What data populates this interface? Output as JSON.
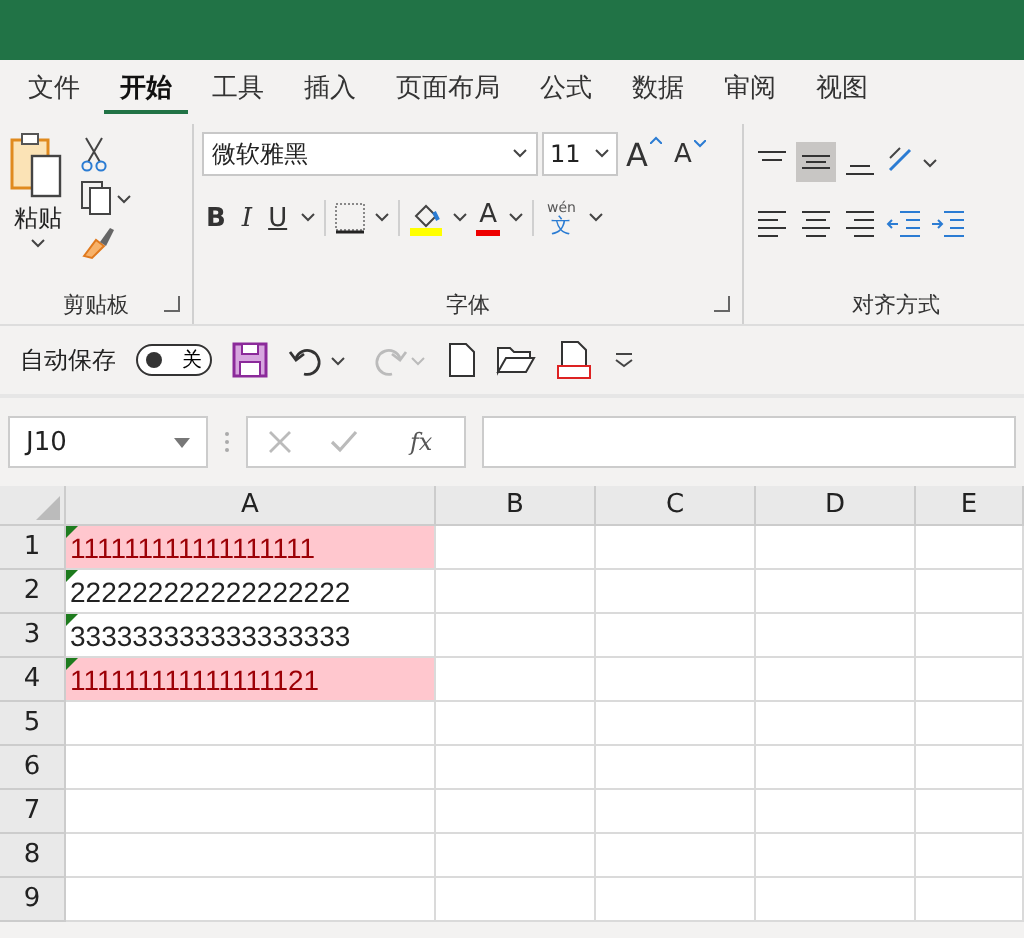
{
  "tabs": [
    {
      "label": "文件",
      "selected": false
    },
    {
      "label": "开始",
      "selected": true
    },
    {
      "label": "工具",
      "selected": false
    },
    {
      "label": "插入",
      "selected": false
    },
    {
      "label": "页面布局",
      "selected": false
    },
    {
      "label": "公式",
      "selected": false
    },
    {
      "label": "数据",
      "selected": false
    },
    {
      "label": "审阅",
      "selected": false
    },
    {
      "label": "视图",
      "selected": false
    }
  ],
  "ribbon": {
    "clipboard": {
      "paste_label": "粘贴",
      "group_label": "剪贴板"
    },
    "font": {
      "font_name": "微软雅黑",
      "font_size": "11",
      "grow": "A",
      "shrink": "A",
      "bold": "B",
      "italic": "I",
      "underline": "U",
      "font_color_letter": "A",
      "phonetic_top": "wén",
      "phonetic_bottom": "文",
      "group_label": "字体"
    },
    "alignment": {
      "group_label": "对齐方式",
      "middle_selected": true
    }
  },
  "quick_access": {
    "autosave_label": "自动保存",
    "autosave_on": false,
    "toggle_text": "关"
  },
  "formula_bar": {
    "name_box": "J10",
    "fx": "fx"
  },
  "sheet": {
    "columns": [
      "A",
      "B",
      "C",
      "D",
      "E"
    ],
    "rows": [
      {
        "number": "1",
        "value": "111111111111111111",
        "highlighted": true,
        "flag": true
      },
      {
        "number": "2",
        "value": "222222222222222222",
        "highlighted": false,
        "flag": true
      },
      {
        "number": "3",
        "value": "333333333333333333",
        "highlighted": false,
        "flag": true
      },
      {
        "number": "4",
        "value": "111111111111111121",
        "highlighted": true,
        "flag": true
      },
      {
        "number": "5",
        "value": "",
        "highlighted": false,
        "flag": false
      },
      {
        "number": "6",
        "value": "",
        "highlighted": false,
        "flag": false
      },
      {
        "number": "7",
        "value": "",
        "highlighted": false,
        "flag": false
      },
      {
        "number": "8",
        "value": "",
        "highlighted": false,
        "flag": false
      },
      {
        "number": "9",
        "value": "",
        "highlighted": false,
        "flag": false
      }
    ]
  }
}
